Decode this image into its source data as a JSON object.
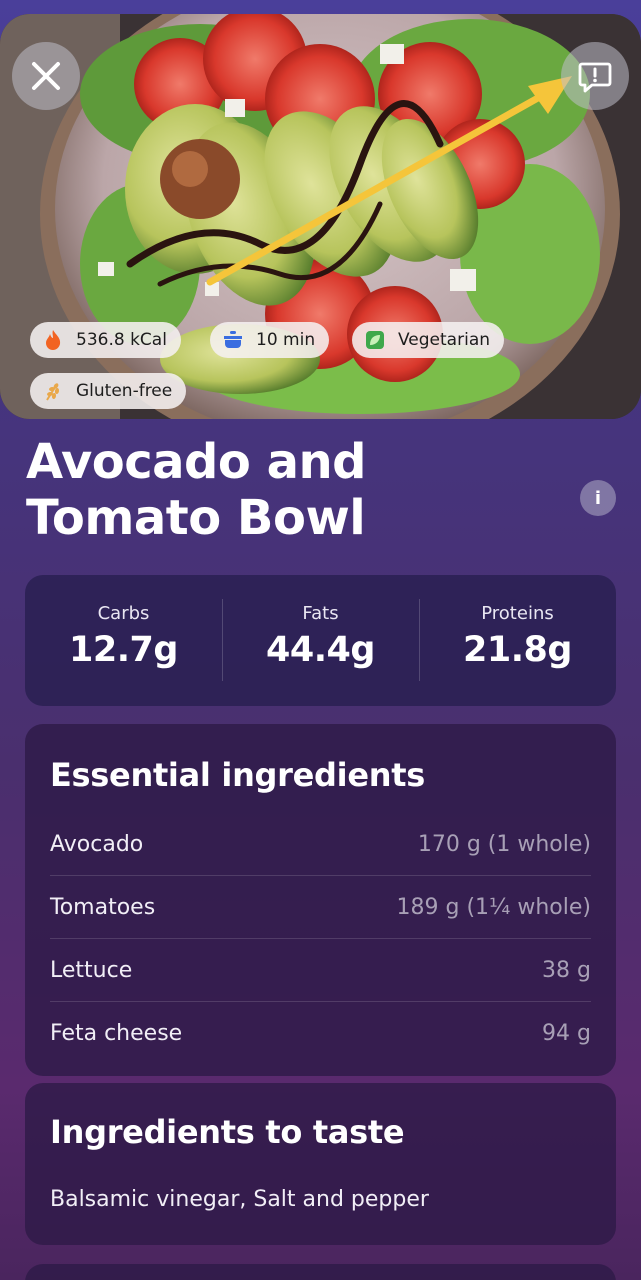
{
  "hero": {
    "tags": [
      {
        "icon": "flame-icon",
        "label": "536.8 kCal"
      },
      {
        "icon": "pot-icon",
        "label": "10 min"
      },
      {
        "icon": "leaf-icon",
        "label": "Vegetarian"
      },
      {
        "icon": "wheat-icon",
        "label": "Gluten-free"
      }
    ]
  },
  "recipe": {
    "title": "Avocado and Tomato Bowl"
  },
  "macros": [
    {
      "label": "Carbs",
      "value": "12.7g"
    },
    {
      "label": "Fats",
      "value": "44.4g"
    },
    {
      "label": "Proteins",
      "value": "21.8g"
    }
  ],
  "essential": {
    "title": "Essential ingredients",
    "items": [
      {
        "name": "Avocado",
        "amount": "170 g (1 whole)"
      },
      {
        "name": "Tomatoes",
        "amount": "189 g (1¼ whole)"
      },
      {
        "name": "Lettuce",
        "amount": "38 g"
      },
      {
        "name": "Feta cheese",
        "amount": "94 g"
      }
    ]
  },
  "taste": {
    "title": "Ingredients to taste",
    "text": "Balsamic vinegar, Salt and pepper"
  },
  "colors": {
    "accent_arrow": "#f5c53a",
    "background_top": "#4a3f9a",
    "background_bottom": "#4a255e"
  }
}
